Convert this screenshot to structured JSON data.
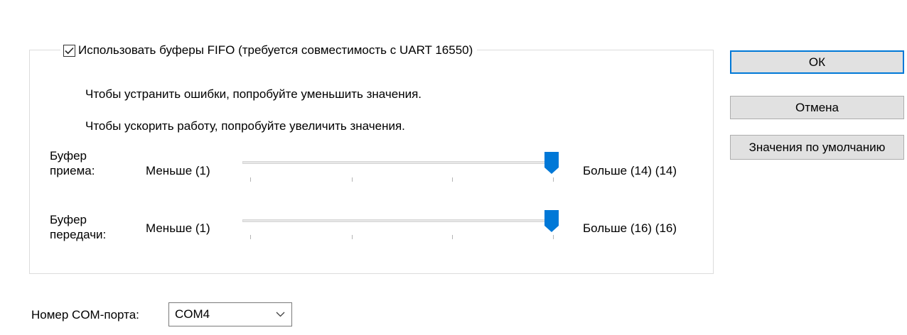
{
  "fifo": {
    "checkbox_label": "Использовать буферы FIFO (требуется совместимость с UART 16550)",
    "checked": true,
    "hint_errors": "Чтобы устранить ошибки, попробуйте уменьшить значения.",
    "hint_speed": "Чтобы ускорить работу, попробуйте увеличить значения."
  },
  "receive_buffer": {
    "label_line1": "Буфер",
    "label_line2": "приема:",
    "min_label": "Меньше (1)",
    "max_label": "Больше (14)",
    "current_value": "(14)",
    "value": 14,
    "min": 1,
    "max": 14
  },
  "transmit_buffer": {
    "label_line1": "Буфер",
    "label_line2": "передачи:",
    "min_label": "Меньше (1)",
    "max_label": "Больше (16)",
    "current_value": "(16)",
    "value": 16,
    "min": 1,
    "max": 16
  },
  "buttons": {
    "ok": "ОК",
    "cancel": "Отмена",
    "defaults": "Значения по умолчанию"
  },
  "com_port": {
    "label": "Номер COM-порта:",
    "selected": "COM4"
  },
  "colors": {
    "accent": "#0078d7",
    "button_face": "#e1e1e1",
    "button_border": "#adadad",
    "group_border": "#dcdcdc"
  },
  "icons": {
    "checkbox": "checkmark-icon",
    "dropdown": "chevron-down-icon"
  }
}
